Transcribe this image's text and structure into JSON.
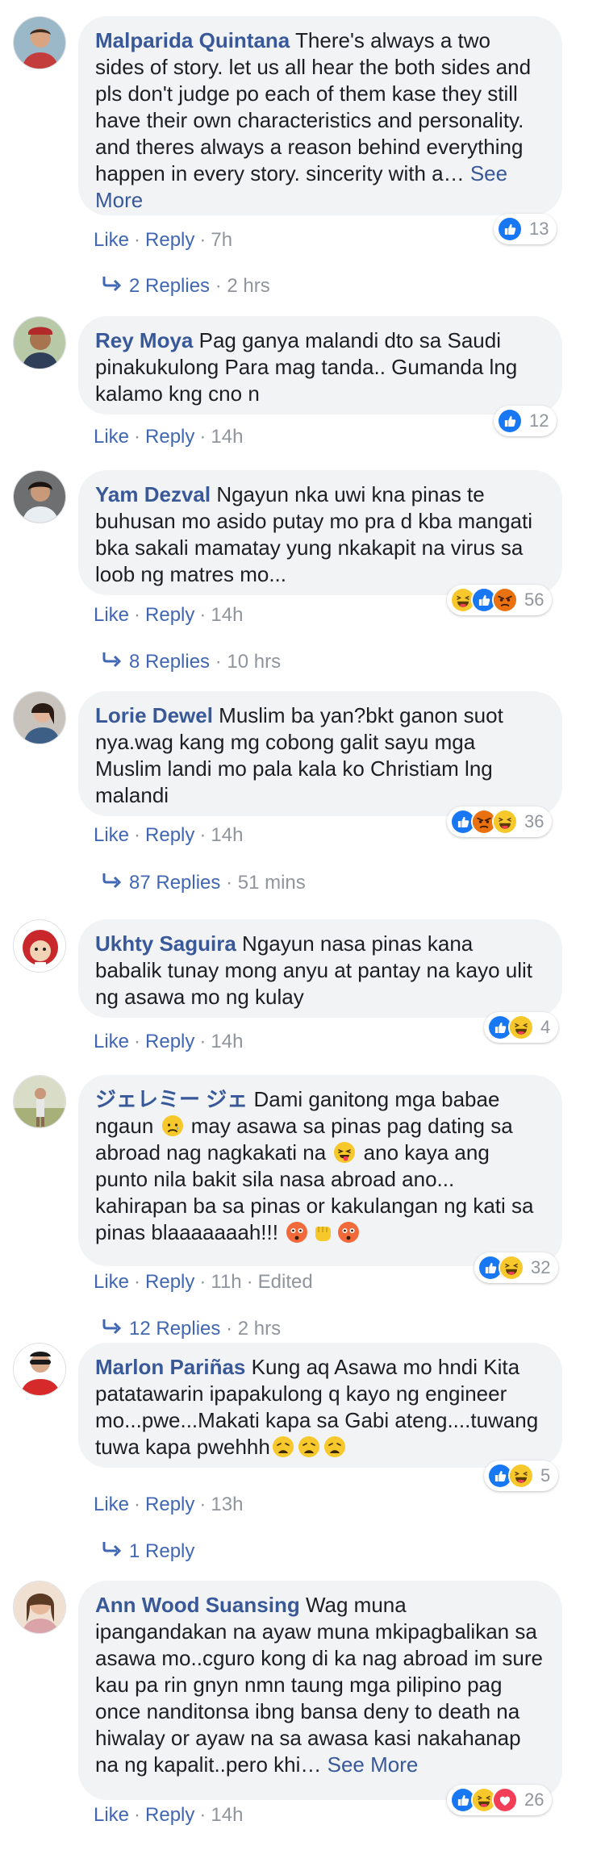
{
  "comments": [
    {
      "author": "Malparida Quintana",
      "text": " There's always a two sides of story. let us all hear the both sides and pls don't judge po each of them kase they still have their own characteristics and personality. and theres always a reason behind everything happen in every story. sincerity with a… ",
      "see_more": "See More",
      "like": "Like",
      "reply": "Reply",
      "time": "7h",
      "reactions": [
        "like"
      ],
      "reaction_count": "13",
      "replies": "2 Replies",
      "replies_time": "2 hrs"
    },
    {
      "author": "Rey Moya",
      "text": " Pag ganya malandi dto sa Saudi pinakukulong Para mag tanda.. Gumanda lng kalamo kng cno n",
      "like": "Like",
      "reply": "Reply",
      "time": "14h",
      "reactions": [
        "like"
      ],
      "reaction_count": "12"
    },
    {
      "author": "Yam Dezval",
      "text": " Ngayun nka uwi kna pinas te buhusan mo asido putay mo pra d kba mangati bka sakali mamatay yung nkakapit na virus sa loob ng matres mo...",
      "like": "Like",
      "reply": "Reply",
      "time": "14h",
      "reactions": [
        "haha",
        "like",
        "angry"
      ],
      "reaction_count": "56",
      "replies": "8 Replies",
      "replies_time": "10 hrs"
    },
    {
      "author": "Lorie Dewel",
      "text": " Muslim ba yan?bkt ganon suot nya.wag kang mg cobong galit sayu mga Muslim landi mo pala kala ko Christiam lng malandi",
      "like": "Like",
      "reply": "Reply",
      "time": "14h",
      "reactions": [
        "like",
        "angry",
        "haha"
      ],
      "reaction_count": "36",
      "replies": "87 Replies",
      "replies_time": "51 mins"
    },
    {
      "author": "Ukhty Saguira",
      "text": " Ngayun nasa pinas kana babalik tunay mong anyu at pantay na kayo ulit ng asawa mo ng kulay",
      "like": "Like",
      "reply": "Reply",
      "time": "14h",
      "reactions": [
        "like",
        "haha"
      ],
      "reaction_count": "4"
    },
    {
      "author": "ジェレミー ジェ",
      "text_parts": [
        " Dami ganitong mga babae ngaun ",
        " may asawa sa pinas pag dating sa abroad nag nagkakati na ",
        " ano kaya ang punto nila bakit sila nasa abroad ano... kahirapan ba sa pinas or kakulangan ng kati sa pinas blaaaaaaah!!! "
      ],
      "like": "Like",
      "reply": "Reply",
      "time": "11h",
      "edited": "Edited",
      "reactions": [
        "like",
        "haha"
      ],
      "reaction_count": "32",
      "replies": "12 Replies",
      "replies_time": "2 hrs"
    },
    {
      "author": "Marlon Pariñas",
      "text": " Kung aq Asawa mo hndi Kita patatawarin ipapakulong q kayo ng engineer mo...pwe...Makati kapa sa Gabi ateng....tuwang tuwa kapa pwehhh",
      "like": "Like",
      "reply": "Reply",
      "time": "13h",
      "reactions": [
        "like",
        "haha"
      ],
      "reaction_count": "5",
      "replies": "1 Reply"
    },
    {
      "author": "Ann Wood Suansing",
      "text": " Wag muna ipangandakan na ayaw muna mkipagbalikan sa asawa mo..cguro kong di ka nag abroad im sure kau pa rin gnyn nmn taung mga pilipino pag once nanditonsa ibng bansa deny to death na hiwalay or ayaw na sa awasa kasi nakahanap na ng kapalit..pero khi… ",
      "see_more": "See More",
      "like": "Like",
      "reply": "Reply",
      "time": "14h",
      "reactions": [
        "like",
        "haha",
        "love"
      ],
      "reaction_count": "26"
    }
  ],
  "icons": {
    "like": "thumbs-up-icon",
    "haha": "laughing-face-icon",
    "angry": "angry-face-icon",
    "love": "heart-icon",
    "reply_arrow": "reply-arrow-icon"
  },
  "colors": {
    "link": "#385898",
    "action": "#4267b2",
    "meta": "#90949c",
    "bubble": "#f2f3f5",
    "like_blue": "#1877f2",
    "haha_yellow": "#f7c82c",
    "angry_orange": "#e9710f",
    "love_red": "#f33e58"
  }
}
